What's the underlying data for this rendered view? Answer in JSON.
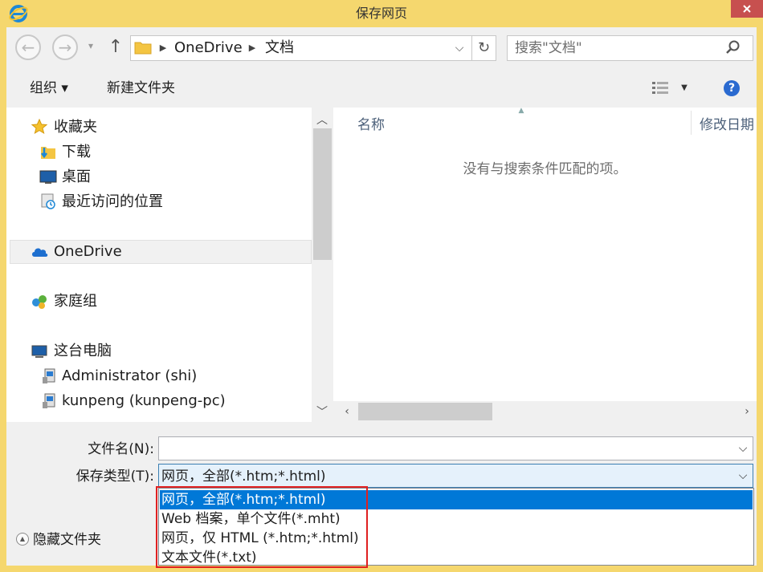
{
  "window": {
    "title": "保存网页",
    "accent_color": "#f5d76e"
  },
  "address_bar": {
    "crumbs": [
      "OneDrive",
      "文档"
    ],
    "search_placeholder": "搜索\"文档\""
  },
  "toolbar": {
    "organize_label": "组织 ▾",
    "new_folder_label": "新建文件夹",
    "help_label": "?"
  },
  "nav_pane": {
    "items": [
      {
        "label": "收藏夹",
        "icon": "star-icon"
      },
      {
        "label": "下载",
        "icon": "download-folder-icon"
      },
      {
        "label": "桌面",
        "icon": "desktop-icon"
      },
      {
        "label": "最近访问的位置",
        "icon": "recent-places-icon"
      },
      {
        "label": "OneDrive",
        "icon": "cloud-icon",
        "selected": true
      },
      {
        "label": "家庭组",
        "icon": "homegroup-icon"
      },
      {
        "label": "这台电脑",
        "icon": "computer-icon"
      },
      {
        "label": "Administrator (shi)",
        "icon": "network-user-icon"
      },
      {
        "label": "kunpeng (kunpeng-pc)",
        "icon": "network-user-icon"
      }
    ]
  },
  "file_list": {
    "columns": [
      "名称",
      "修改日期"
    ],
    "empty_message": "没有与搜索条件匹配的项。"
  },
  "form": {
    "filename_label": "文件名(N):",
    "filename_value": "",
    "type_label": "保存类型(T):",
    "type_value": "网页，全部(*.htm;*.html)",
    "type_options": [
      "网页，全部(*.htm;*.html)",
      "Web 档案，单个文件(*.mht)",
      "网页，仅 HTML (*.htm;*.html)",
      "文本文件(*.txt)"
    ],
    "selected_option_color": "#0078d7",
    "highlight_color": "#e02020"
  },
  "footer": {
    "hide_folders_label": "隐藏文件夹"
  }
}
